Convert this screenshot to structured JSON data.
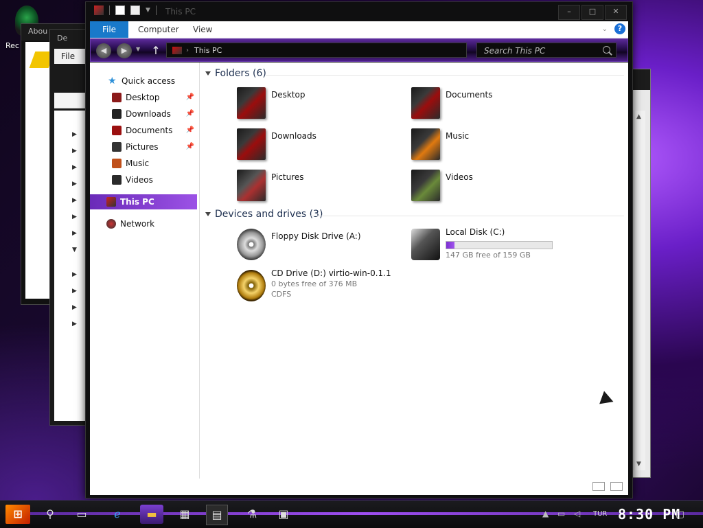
{
  "desktop": {
    "icon_label": "Rec"
  },
  "bg_windows": {
    "win1_title": "Abou",
    "win2_title": "De",
    "win2_menu_file": "File"
  },
  "window": {
    "title": "This PC",
    "minimize": "–",
    "maximize": "□",
    "close": "✕"
  },
  "ribbon": {
    "tabs": [
      "File",
      "Computer",
      "View"
    ],
    "help": "?"
  },
  "navbar": {
    "back": "◀",
    "forward": "▶",
    "up": "↑",
    "address": "This PC",
    "search_placeholder": "Search This PC"
  },
  "nav_pane": {
    "quick_access": "Quick access",
    "items": [
      {
        "label": "Desktop",
        "icon": "desktop-icon",
        "color": "#8b1a1a",
        "pinned": true
      },
      {
        "label": "Downloads",
        "icon": "downloads-icon",
        "color": "#222222",
        "pinned": true
      },
      {
        "label": "Documents",
        "icon": "documents-icon",
        "color": "#9b1010",
        "pinned": true
      },
      {
        "label": "Pictures",
        "icon": "pictures-icon",
        "color": "#333333",
        "pinned": true
      },
      {
        "label": "Music",
        "icon": "music-icon",
        "color": "#c0501a",
        "pinned": false
      },
      {
        "label": "Videos",
        "icon": "videos-icon",
        "color": "#2a2a2a",
        "pinned": false
      }
    ],
    "this_pc": "This PC",
    "network": "Network"
  },
  "folders": {
    "header": "Folders (6)",
    "items": [
      "Desktop",
      "Documents",
      "Downloads",
      "Music",
      "Pictures",
      "Videos"
    ]
  },
  "drives": {
    "header": "Devices and drives (3)",
    "floppy": {
      "name": "Floppy Disk Drive (A:)"
    },
    "local": {
      "name": "Local Disk (C:)",
      "free": "147 GB free of 159 GB",
      "used_fraction": 0.075
    },
    "cd": {
      "name": "CD Drive (D:) virtio-win-0.1.1",
      "free": "0 bytes free of 376 MB",
      "fs": "CDFS"
    }
  },
  "taskbar": {
    "language": "TUR",
    "clock": "8:30 PM"
  },
  "colors": {
    "accent": "#7b2fd0",
    "file_tab": "#1979ca"
  }
}
